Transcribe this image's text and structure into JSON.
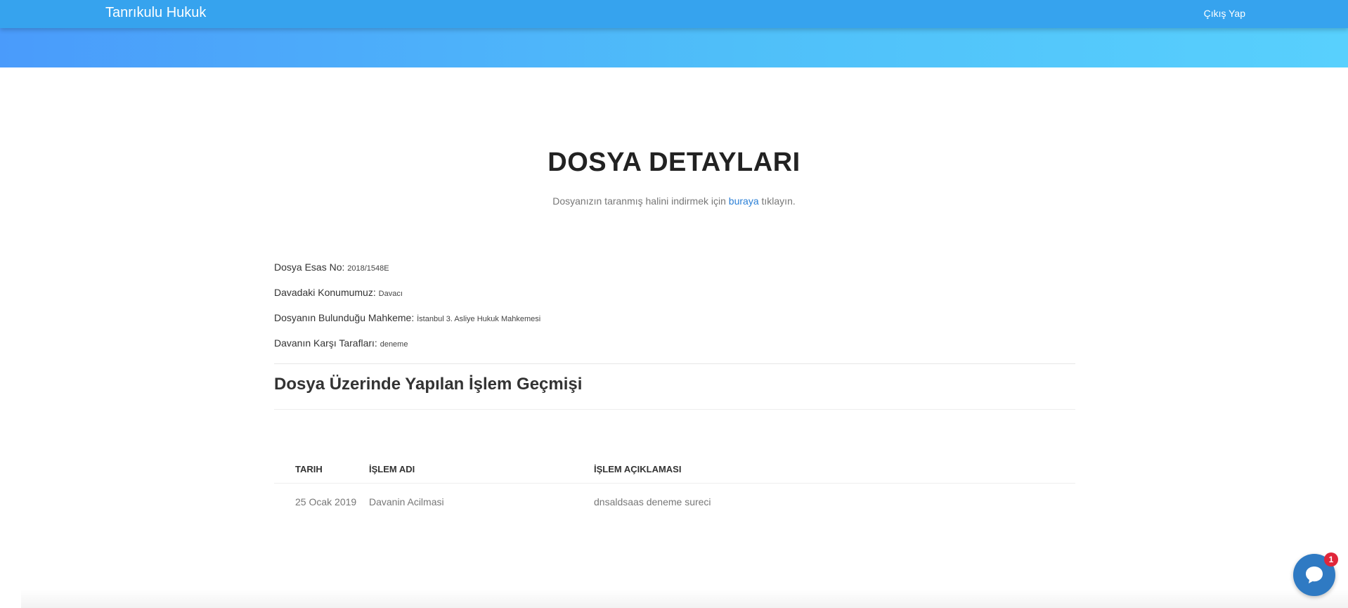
{
  "navbar": {
    "brand": "Tanrıkulu Hukuk",
    "logout_label": "Çıkış Yap"
  },
  "page": {
    "title": "DOSYA DETAYLARI",
    "subtitle_before": "Dosyanızın taranmış halini indirmek için ",
    "subtitle_link": "buraya",
    "subtitle_after": " tıklayın."
  },
  "details": [
    {
      "label": "Dosya Esas No: ",
      "value": "2018/1548E"
    },
    {
      "label": "Davadaki Konumumuz: ",
      "value": "Davacı"
    },
    {
      "label": "Dosyanın Bulunduğu Mahkeme: ",
      "value": "İstanbul 3. Asliye Hukuk Mahkemesi"
    },
    {
      "label": "Davanın Karşı Tarafları: ",
      "value": "deneme"
    }
  ],
  "history": {
    "title": "Dosya Üzerinde Yapılan İşlem Geçmişi",
    "columns": [
      "TARIH",
      "İŞLEM ADI",
      "İŞLEM AÇIKLAMASI"
    ],
    "rows": [
      [
        "25 Ocak 2019",
        "Davanin Acilmasi",
        "dnsaldsaas deneme sureci"
      ]
    ]
  },
  "chat": {
    "badge_count": "1",
    "icon": "chat-bubble-icon"
  },
  "colors": {
    "navbar": "#36a3ee",
    "link": "#2a7fd6",
    "badge": "#e0263a",
    "chat": "#2f7ac3"
  }
}
